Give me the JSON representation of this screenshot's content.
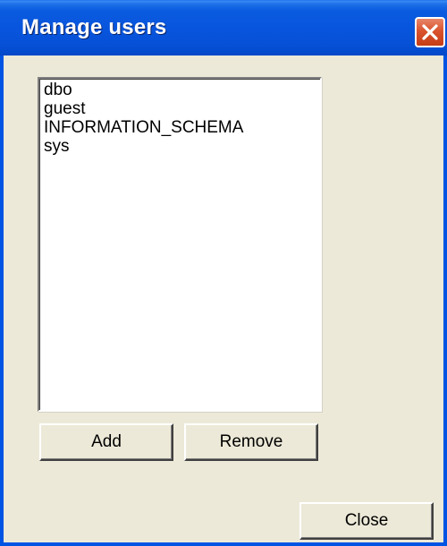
{
  "window": {
    "title": "Manage users",
    "close_icon": "close-icon"
  },
  "users": {
    "items": [
      {
        "label": "dbo"
      },
      {
        "label": "guest"
      },
      {
        "label": "INFORMATION_SCHEMA"
      },
      {
        "label": "sys"
      }
    ]
  },
  "buttons": {
    "add_label": "Add",
    "remove_label": "Remove",
    "close_label": "Close"
  },
  "colors": {
    "titlebar": "#0855dd",
    "window_bg": "#ece9d8",
    "close_button": "#d9532e"
  }
}
